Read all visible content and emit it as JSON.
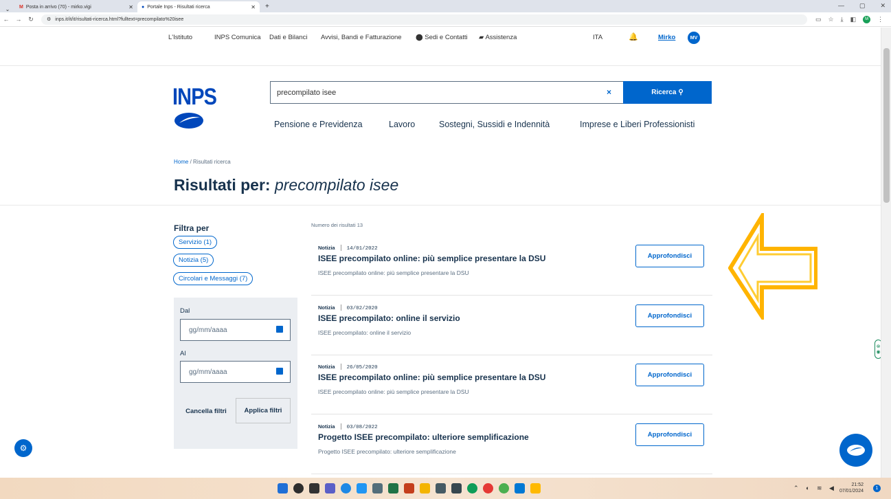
{
  "browser": {
    "tabs": [
      {
        "label": "Posta in arrivo (70) - mirko.vigi",
        "icon": "gmail-icon"
      },
      {
        "label": "Portale Inps - Risultati ricerca",
        "icon": "inps-icon"
      }
    ],
    "new_tab": "+",
    "url": "inps.it/it/it/risultati-ricerca.html?fulltext=precompilato%20isee"
  },
  "topnav": {
    "items": [
      "L'Istituto",
      "INPS Comunica",
      "Dati e Bilanci",
      "Avvisi, Bandi e Fatturazione",
      "Sedi e Contatti",
      "Assistenza"
    ],
    "lang": "ITA",
    "user_name": "Mirko",
    "user_initials": "MV"
  },
  "logo": {
    "text": "INPS"
  },
  "search": {
    "value": "precompilato isee",
    "clear": "×",
    "button_label": "Ricerca"
  },
  "mainnav": [
    "Pensione e Previdenza",
    "Lavoro",
    "Sostegni, Sussidi e Indennità",
    "Imprese e Liberi Professionisti"
  ],
  "breadcrumb": {
    "home": "Home",
    "separator": "/",
    "current": "Risultati ricerca"
  },
  "heading": {
    "prefix": "Risultati per:",
    "query": "precompilato isee"
  },
  "filters": {
    "title": "Filtra per",
    "chips": [
      "Servizio (1)",
      "Notizia (5)",
      "Circolari e Messaggi (7)"
    ],
    "dal_label": "Dal",
    "al_label": "Al",
    "date_placeholder": "gg/mm/aaaa",
    "cancel_label": "Cancella filtri",
    "apply_label": "Applica filtri"
  },
  "results_count": "Numero dei risultati 13",
  "results": [
    {
      "kind": "Notizia",
      "date": "14/01/2022",
      "title": "ISEE precompilato online: più semplice presentare la DSU",
      "desc": "ISEE precompilato online: più semplice presentare la DSU",
      "button": "Approfondisci"
    },
    {
      "kind": "Notizia",
      "date": "03/02/2020",
      "title": "ISEE precompilato: online il servizio",
      "desc": "ISEE precompilato: online il servizio",
      "button": "Approfondisci"
    },
    {
      "kind": "Notizia",
      "date": "26/05/2020",
      "title": "ISEE precompilato online: più semplice presentare la DSU",
      "desc": "ISEE precompilato online: più semplice presentare la DSU",
      "button": "Approfondisci"
    },
    {
      "kind": "Notizia",
      "date": "03/08/2022",
      "title": "Progetto ISEE precompilato: ulteriore semplificazione",
      "desc": "Progetto ISEE precompilato: ulteriore semplificazione",
      "button": "Approfondisci"
    }
  ],
  "taskbar": {
    "time": "21:52",
    "date": "07/01/2024",
    "notifications": "1"
  },
  "colors": {
    "brand": "#0066cc",
    "text": "#17324d",
    "arrow": "#ffb400"
  }
}
